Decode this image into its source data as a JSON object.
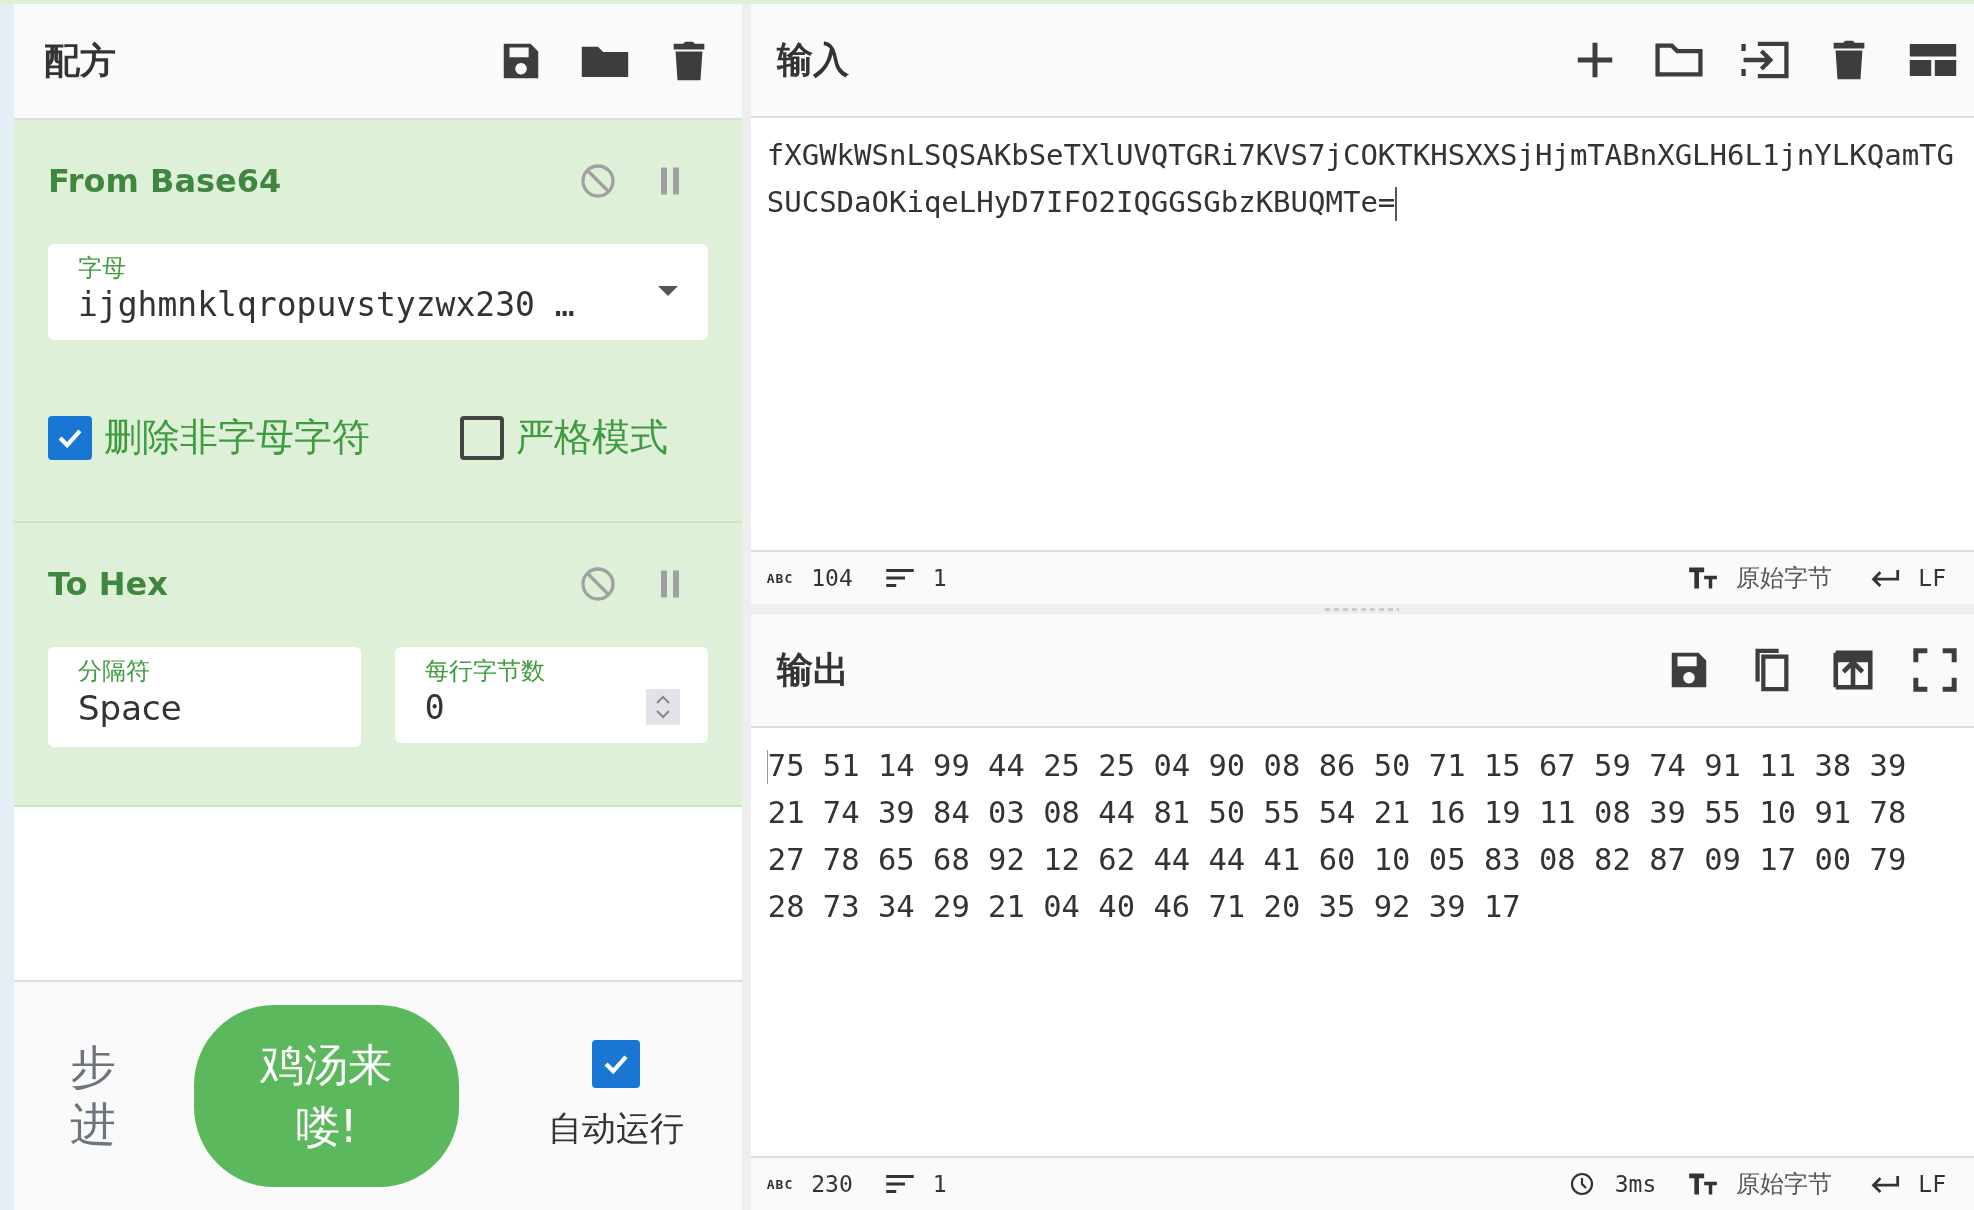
{
  "recipe": {
    "title": "配方",
    "operations": [
      {
        "name": "From Base64",
        "args": [
          {
            "kind": "dropdown",
            "label": "字母",
            "value": "ijghmnklqropuvstyzwx230 …"
          },
          {
            "kind": "checkbox",
            "label": "删除非字母字符",
            "checked": true
          },
          {
            "kind": "checkbox",
            "label": "严格模式",
            "checked": false
          }
        ]
      },
      {
        "name": "To Hex",
        "args": [
          {
            "kind": "text",
            "label": "分隔符",
            "value": "Space"
          },
          {
            "kind": "number",
            "label": "每行字节数",
            "value": "0"
          }
        ]
      }
    ]
  },
  "controls": {
    "step": "步进",
    "bake": "鸡汤来喽!",
    "auto_bake": {
      "label": "自动运行",
      "checked": true
    }
  },
  "input": {
    "title": "输入",
    "text": "fXGWkWSnLSQSAKbSeTXlUVQTGRi7KVS7jCOKTKHSXXSjHjmTABnXGLH6L1jnYLKQamTGSUCSDaOKiqeLHyD7IFO2IQGGSGbzKBUQMTe=",
    "status": {
      "abc": "ABC",
      "length": "104",
      "lines": "1",
      "encoding": "原始字节",
      "eol": "LF"
    }
  },
  "output": {
    "title": "输出",
    "text": "75 51 14 99 44 25 25 04 90 08 86 50 71 15 67 59 74 91 11 38 39 21 74 39 84 03 08 44 81 50 55 54 21 16 19 11 08 39 55 10 91 78 27 78 65 68 92 12 62 44 44 41 60 10 05 83 08 82 87 09 17 00 79 28 73 34 29 21 04 40 46 71 20 35 92 39 17",
    "status": {
      "abc": "ABC",
      "length": "230",
      "lines": "1",
      "time": "3ms",
      "encoding": "原始字节",
      "eol": "LF"
    }
  }
}
